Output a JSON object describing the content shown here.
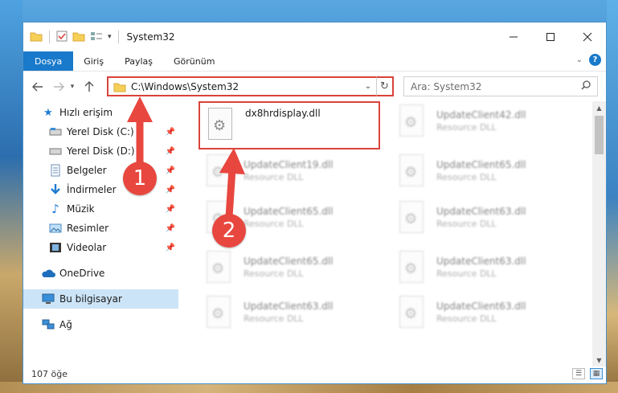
{
  "window": {
    "title": "System32"
  },
  "ribbon": {
    "tabs": [
      "Dosya",
      "Giriş",
      "Paylaş",
      "Görünüm"
    ]
  },
  "address": {
    "path": "C:\\Windows\\System32",
    "search_placeholder": "Ara: System32"
  },
  "nav": {
    "quick_access": "Hızlı erişim",
    "items": [
      {
        "label": "Yerel Disk (C:)",
        "icon": "drive-icon",
        "pinned": true
      },
      {
        "label": "Yerel Disk (D:)",
        "icon": "drive-icon",
        "pinned": true
      },
      {
        "label": "Belgeler",
        "icon": "documents-icon",
        "pinned": true
      },
      {
        "label": "İndirmeler",
        "icon": "download-icon",
        "pinned": true
      },
      {
        "label": "Müzik",
        "icon": "music-icon",
        "pinned": true
      },
      {
        "label": "Resimler",
        "icon": "pictures-icon",
        "pinned": true
      },
      {
        "label": "Videolar",
        "icon": "videos-icon",
        "pinned": true
      }
    ],
    "onedrive": "OneDrive",
    "this_pc": "Bu bilgisayar",
    "network": "Ağ"
  },
  "files": [
    {
      "name": "dx8hrdisplay.dll",
      "desc": ""
    },
    {
      "name": "UpdateClient42.dll",
      "desc": "Resource DLL"
    },
    {
      "name": "UpdateClient19.dll",
      "desc": "Resource DLL"
    },
    {
      "name": "UpdateClient65.dll",
      "desc": "Resource DLL"
    },
    {
      "name": "UpdateClient65.dll",
      "desc": "Resource DLL"
    },
    {
      "name": "UpdateClient63.dll",
      "desc": "Resource DLL"
    },
    {
      "name": "UpdateClient65.dll",
      "desc": "Resource DLL"
    },
    {
      "name": "UpdateClient63.dll",
      "desc": "Resource DLL"
    },
    {
      "name": "UpdateClient63.dll",
      "desc": "Resource DLL"
    },
    {
      "name": "UpdateClient63.dll",
      "desc": "Resource DLL"
    }
  ],
  "status": {
    "count": "107 öğe"
  },
  "annotations": {
    "step1": "1",
    "step2": "2",
    "color": "#e8473f"
  }
}
